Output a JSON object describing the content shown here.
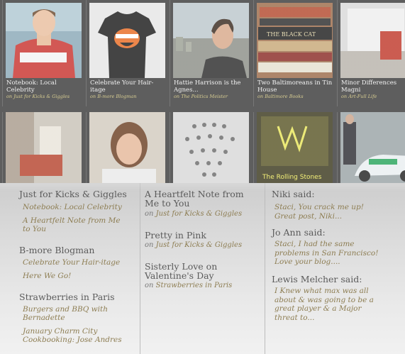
{
  "featured": {
    "row1": [
      {
        "title": "Notebook: Local Celebrity",
        "on": "on",
        "source": "Just for Kicks & Giggles"
      },
      {
        "title": "Celebrate Your Hair-itage",
        "on": "on",
        "source": "B-more Blogman"
      },
      {
        "title": "Hattie Harrison is the Agnes...",
        "on": "on",
        "source": "The Politics Meister"
      },
      {
        "title": "Two Baltimoreans in Tin House",
        "on": "on",
        "source": "Baltimore Books"
      },
      {
        "title": "Minor Differences Magni",
        "on": "on",
        "source": "Art-Full Life"
      }
    ],
    "row2_count": 5,
    "shirt_text": "BLAST",
    "book_text": "THE BLACK CAT",
    "album_text": "The Rolling Stones"
  },
  "blogs": [
    {
      "name": "Just for Kicks & Giggles",
      "posts": [
        "Notebook: Local Celebrity",
        "A Heartfelt Note from Me to You"
      ]
    },
    {
      "name": "B-more Blogman",
      "posts": [
        "Celebrate Your Hair-itage",
        "Here We Go!"
      ]
    },
    {
      "name": "Strawberries in Paris",
      "posts": [
        "Burgers and BBQ with Bernadette",
        "January Charm City Cookbooking: Jose Andres"
      ]
    }
  ],
  "popular": [
    {
      "title": "A Heartfelt Note from Me to You",
      "on": "on",
      "source": "Just for Kicks & Giggles"
    },
    {
      "title": "Pretty in Pink",
      "on": "on",
      "source": "Just for Kicks & Giggles"
    },
    {
      "title": "Sisterly Love on Valentine's Day",
      "on": "on",
      "source": "Strawberries in Paris"
    }
  ],
  "comments": [
    {
      "name": "Niki said:",
      "text": "Staci, You crack me up! Great post, Niki..."
    },
    {
      "name": "Jo Ann said:",
      "text": "Staci, I had the same problems in San Francisco! Love your blog...."
    },
    {
      "name": "Lewis Melcher said:",
      "text": "I Knew what max was all about & was going to be a great player & a Major threat to..."
    }
  ]
}
